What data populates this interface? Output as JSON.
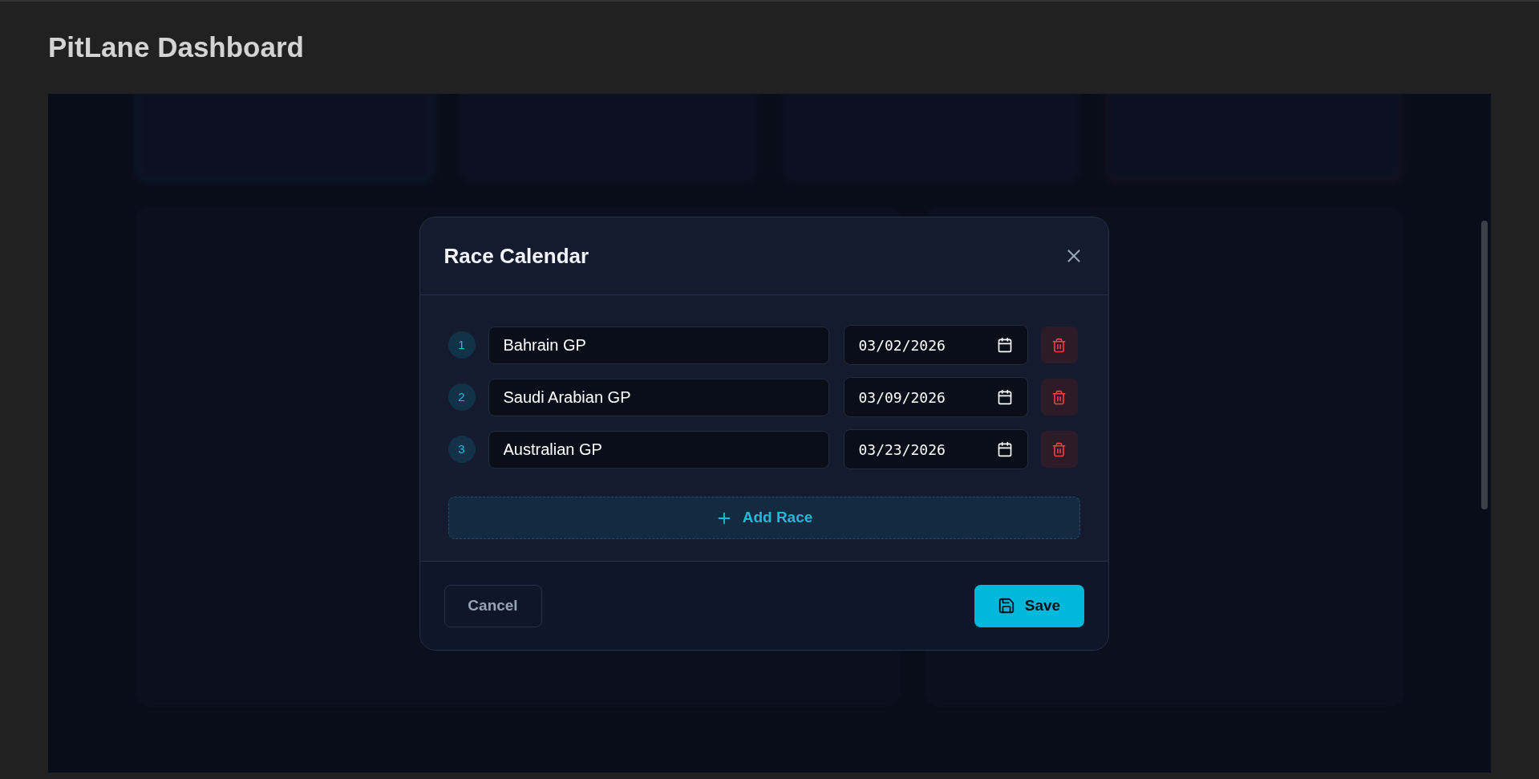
{
  "page": {
    "title": "PitLane Dashboard"
  },
  "dialog": {
    "title": "Race Calendar",
    "races": [
      {
        "number": "1",
        "name": "Bahrain GP",
        "date": "03/02/2026"
      },
      {
        "number": "2",
        "name": "Saudi Arabian GP",
        "date": "03/09/2026"
      },
      {
        "number": "3",
        "name": "Australian GP",
        "date": "03/23/2026"
      }
    ],
    "add_button": "Add Race",
    "cancel_button": "Cancel",
    "save_button": "Save"
  }
}
